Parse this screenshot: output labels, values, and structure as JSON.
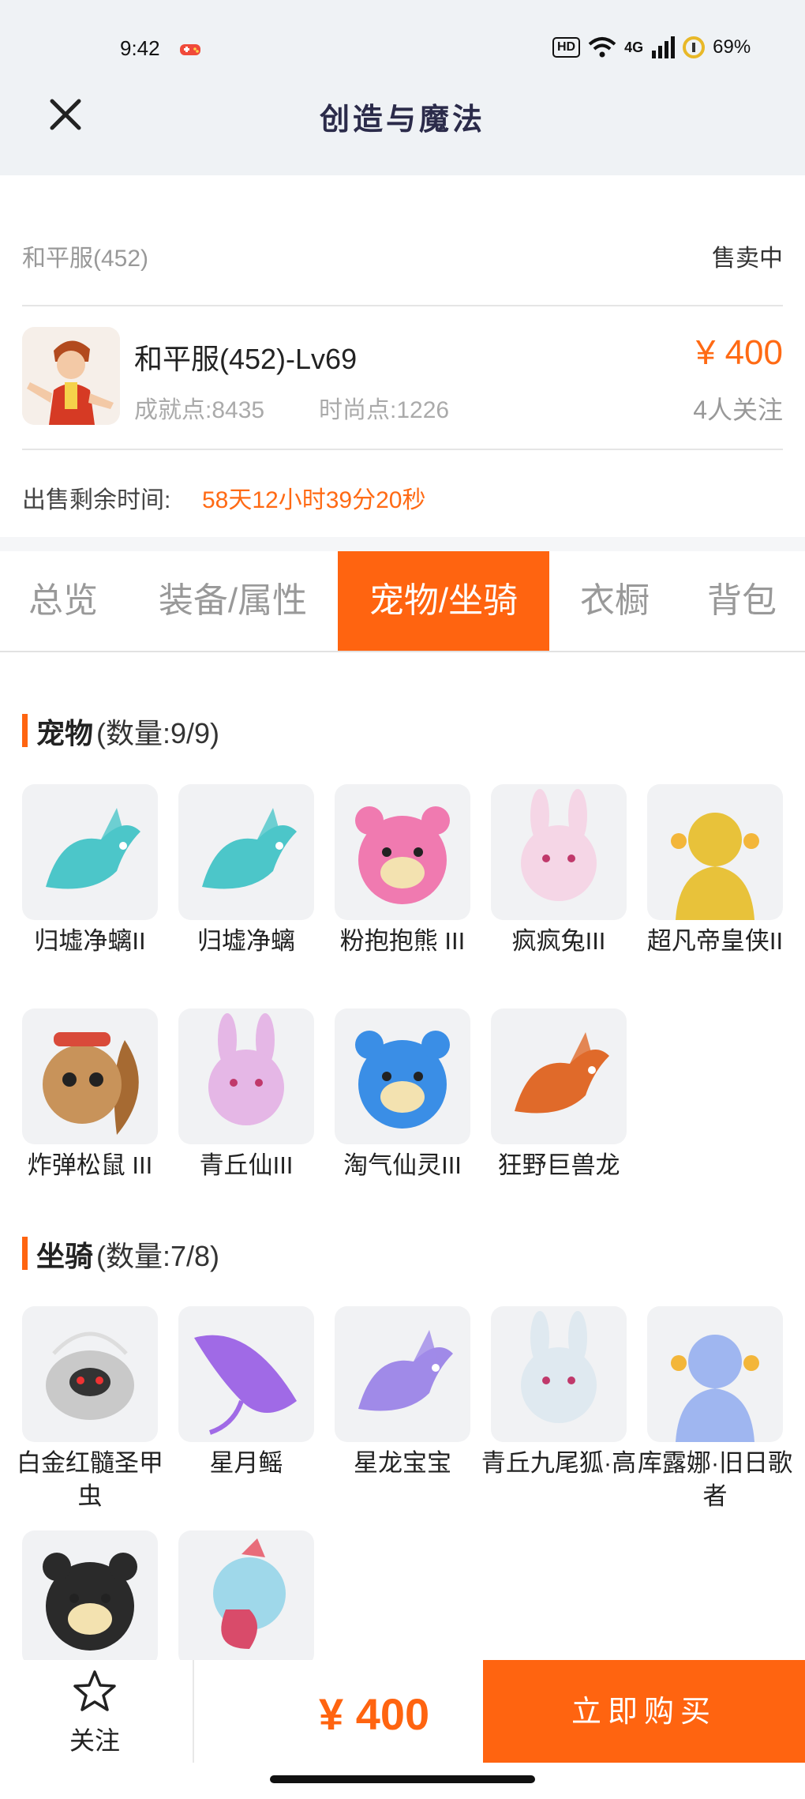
{
  "status": {
    "time": "9:42",
    "network_badge": "HD",
    "network_type": "4G",
    "battery": "69%"
  },
  "header": {
    "title": "创造与魔法",
    "close_icon": "close-icon"
  },
  "listing": {
    "server": "和平服(452)",
    "sale_status": "售卖中",
    "character_name": "和平服(452)-Lv69",
    "achievement": "成就点:8435",
    "fashion": "时尚点:1226",
    "price": "¥ 400",
    "followers": "4人关注",
    "remaining_label": "出售剩余时间:",
    "remaining_value": "58天12小时39分20秒"
  },
  "tabs": [
    {
      "label": "总览",
      "active": false
    },
    {
      "label": "装备/属性",
      "active": false
    },
    {
      "label": "宠物/坐骑",
      "active": true
    },
    {
      "label": "衣橱",
      "active": false
    },
    {
      "label": "背包",
      "active": false
    }
  ],
  "pets": {
    "title": "宠物",
    "count": "(数量:9/9)",
    "items": [
      {
        "name": "归墟净螭II",
        "icon": "dragon-pet-icon",
        "color": "#4cc6c9"
      },
      {
        "name": "归墟净螭",
        "icon": "dragon-pet-icon",
        "color": "#4cc6c9"
      },
      {
        "name": "粉抱抱熊 III",
        "icon": "bear-pet-icon",
        "color": "#f07ab0"
      },
      {
        "name": "疯疯兔III",
        "icon": "rabbit-pet-icon",
        "color": "#f5d6e6"
      },
      {
        "name": "超凡帝皇侠II",
        "icon": "armor-hero-icon",
        "color": "#e8c23a"
      },
      {
        "name": "炸弹松鼠 III",
        "icon": "squirrel-pet-icon",
        "color": "#c8935a"
      },
      {
        "name": "青丘仙III",
        "icon": "fox-fairy-icon",
        "color": "#e5b7e6"
      },
      {
        "name": "淘气仙灵III",
        "icon": "puppy-pet-icon",
        "color": "#3a8ee6"
      },
      {
        "name": "狂野巨兽龙",
        "icon": "dinosaur-pet-icon",
        "color": "#e06a2a"
      }
    ]
  },
  "mounts": {
    "title": "坐骑",
    "count": "(数量:7/8)",
    "items": [
      {
        "name": "白金红髓圣甲虫",
        "icon": "beetle-mount-icon",
        "color": "#c9c9c9"
      },
      {
        "name": "星月鳐",
        "icon": "ray-mount-icon",
        "color": "#a06ae6"
      },
      {
        "name": "星龙宝宝",
        "icon": "baby-dragon-mount-icon",
        "color": "#a08ae8"
      },
      {
        "name": "青丘九尾狐·高",
        "icon": "ninetail-fox-mount-icon",
        "color": "#dfe9f0"
      },
      {
        "name": "库露娜·旧日歌者",
        "icon": "singer-mount-icon",
        "color": "#9fb6f0"
      },
      {
        "name": "",
        "icon": "pig-mount-icon",
        "color": "#2a2a2a"
      },
      {
        "name": "",
        "icon": "bird-mount-icon",
        "color": "#d94b6a"
      }
    ]
  },
  "bottom": {
    "follow_label": "关注",
    "price": "¥ 400",
    "buy_label": "立即购买"
  },
  "colors": {
    "accent": "#ff6410",
    "header_bg": "#eff2f5"
  }
}
